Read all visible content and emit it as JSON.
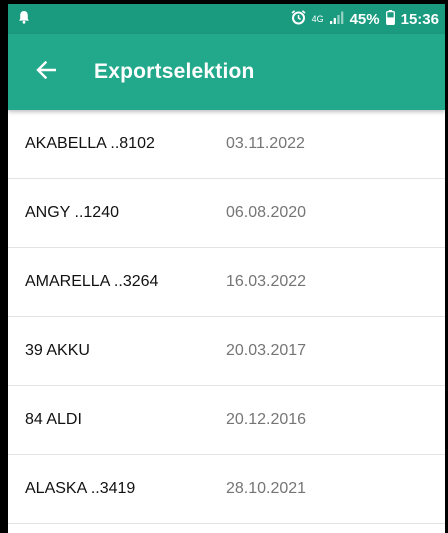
{
  "status_bar": {
    "network": "4G",
    "battery": "45%",
    "time": "15:36",
    "icons": [
      "notification-bell-icon",
      "alarm-icon",
      "signal-icon",
      "battery-icon"
    ]
  },
  "app_bar": {
    "title": "Exportselektion",
    "back_icon": "arrow-back-icon"
  },
  "colors": {
    "status_bar": "#1a9b7f",
    "app_bar": "#22a88a",
    "date_text": "#757575"
  },
  "items": [
    {
      "name": "AKABELLA ..8102",
      "date": "03.11.2022"
    },
    {
      "name": "ANGY ..1240",
      "date": "06.08.2020"
    },
    {
      "name": "AMARELLA ..3264",
      "date": "16.03.2022"
    },
    {
      "name": "39 AKKU",
      "date": "20.03.2017"
    },
    {
      "name": "84 ALDI",
      "date": "20.12.2016"
    },
    {
      "name": "ALASKA ..3419",
      "date": "28.10.2021"
    }
  ]
}
